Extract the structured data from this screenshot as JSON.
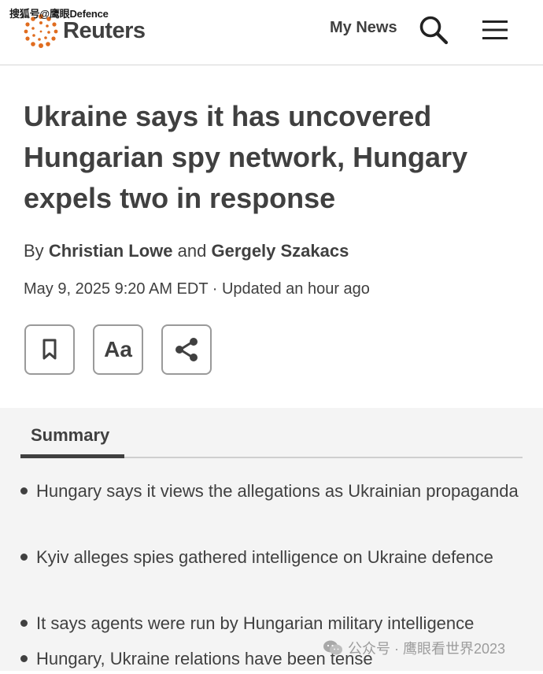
{
  "overlay_source": "搜狐号@鹰眼Defence",
  "header": {
    "logo_text": "Reuters",
    "my_news_label": "My News",
    "search_icon": "search-icon",
    "menu_icon": "hamburger-menu-icon"
  },
  "article": {
    "headline": "Ukraine says it has uncovered Hungarian spy network, Hungary expels two in response",
    "byline_prefix": "By",
    "author1": "Christian Lowe",
    "byline_and": "and",
    "author2": "Gergely Szakacs",
    "dateline": "May 9, 2025 9:20 AM EDT · Updated an hour ago",
    "tools": {
      "bookmark_icon": "bookmark-icon",
      "text_size_label": "Aa",
      "share_icon": "share-icon"
    }
  },
  "summary": {
    "tab_label": "Summary",
    "bullets": [
      "Hungary says it views the allegations as Ukrainian propaganda",
      "Kyiv alleges spies gathered intelligence on Ukraine defence",
      "It says agents were run by Hungarian military intelligence",
      "Hungary, Ukraine relations have been tense"
    ]
  },
  "watermark": {
    "text": "公众号 · 鹰眼看世界2023",
    "icon": "wechat-icon"
  },
  "colors": {
    "text": "#404040",
    "logo_orange": "#e06c1f",
    "summary_bg": "#f4f4f4"
  }
}
